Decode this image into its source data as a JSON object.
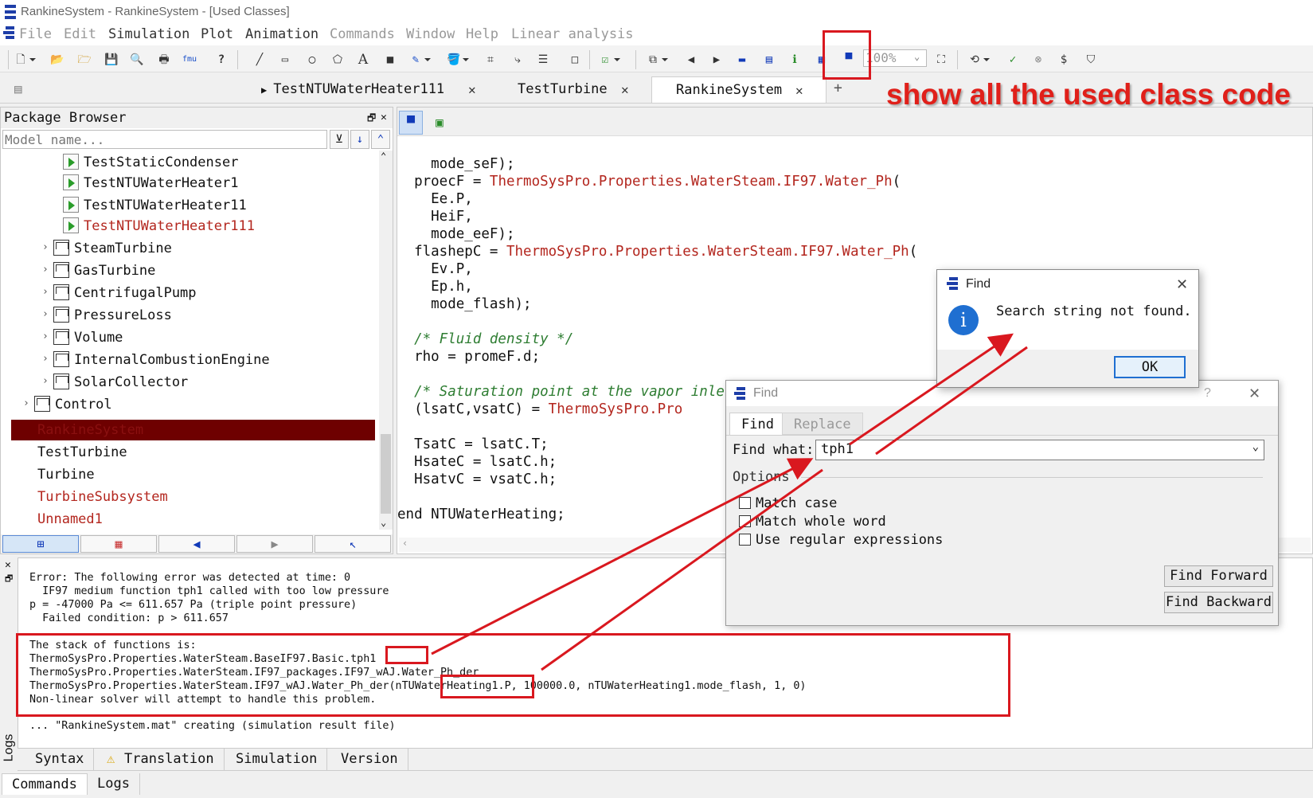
{
  "window": {
    "title": "RankineSystem - RankineSystem - [Used Classes]"
  },
  "menu": [
    "File",
    "Edit",
    "Simulation",
    "Plot",
    "Animation",
    "Commands",
    "Window",
    "Help",
    "Linear analysis"
  ],
  "toolbar": {
    "zoom": "100%"
  },
  "tabs": [
    {
      "label": "TestNTUWaterHeater111"
    },
    {
      "label": "TestTurbine"
    },
    {
      "label": "RankineSystem"
    }
  ],
  "annotation": "show all the used class code",
  "package_browser": {
    "title": "Package Browser",
    "search_placeholder": "Model name...",
    "items": [
      {
        "label": "TestStaticCondenser"
      },
      {
        "label": "TestNTUWaterHeater1"
      },
      {
        "label": "TestNTUWaterHeater11"
      },
      {
        "label": "TestNTUWaterHeater111"
      },
      {
        "label": "SteamTurbine"
      },
      {
        "label": "GasTurbine"
      },
      {
        "label": "CentrifugalPump"
      },
      {
        "label": "PressureLoss"
      },
      {
        "label": "Volume"
      },
      {
        "label": "InternalCombustionEngine"
      },
      {
        "label": "SolarCollector"
      },
      {
        "label": "Control"
      },
      {
        "label": "RankineSystem"
      },
      {
        "label": "TestTurbine"
      },
      {
        "label": "Turbine"
      },
      {
        "label": "TurbineSubsystem"
      },
      {
        "label": "Unnamed1"
      }
    ]
  },
  "code": {
    "l1": "    mode_seF);",
    "l2a": "  proecF = ",
    "l2b": "ThermoSysPro.Properties.WaterSteam.IF97.Water_Ph",
    "l2c": "(",
    "l3": "    Ee.P,",
    "l4": "    HeiF,",
    "l5": "    mode_eeF);",
    "l6a": "  flashepC = ",
    "l6b": "ThermoSysPro.Properties.WaterSteam.IF97.Water_Ph",
    "l6c": "(",
    "l7": "    Ev.P,",
    "l8": "    Ep.h,",
    "l9": "    mode_flash);",
    "l10": "  /* Fluid density */",
    "l11": "  rho = promeF.d;",
    "l12": "  /* Saturation point at the vapor inlet pressure */",
    "l13a": "  (lsatC,vsatC) = ",
    "l13b": "ThermoSysPro.Pro",
    "l14": "  TsatC = lsatC.T;",
    "l15": "  HsateC = lsatC.h;",
    "l16": "  HsatvC = vsatC.h;",
    "l17": "end NTUWaterHeating;"
  },
  "find_dialog": {
    "title": "Find",
    "help": "?",
    "tab_find": "Find",
    "tab_replace": "Replace",
    "find_what_label": "Find what:",
    "find_what_value": "tph1",
    "options_label": "Options",
    "match_case": "Match case",
    "match_whole_word": "Match whole word",
    "use_regex": "Use regular expressions",
    "find_forward": "Find Forward",
    "find_backward": "Find Backward"
  },
  "message_box": {
    "title": "Find",
    "text": "Search string not found.",
    "ok": "OK"
  },
  "logs": {
    "lines": [
      "Error: The following error was detected at time: 0",
      "  IF97 medium function tph1 called with too low pressure",
      "p = -47000 Pa <= 611.657 Pa (triple point pressure)",
      "  Failed condition: p > 611.657",
      "The stack of functions is:",
      "ThermoSysPro.Properties.WaterSteam.BaseIF97.Basic.tph1",
      "ThermoSysPro.Properties.WaterSteam.IF97_packages.IF97_wAJ.Water_Ph_der",
      "ThermoSysPro.Properties.WaterSteam.IF97_wAJ.Water_Ph_der(nTUWaterHeating1.P, 100000.0, nTUWaterHeating1.mode_flash, 1, 0)",
      "Non-linear solver will attempt to handle this problem.",
      "... \"RankineSystem.mat\" creating (simulation result file)"
    ],
    "side_label": "Logs"
  },
  "bottom_tabs": [
    "Syntax",
    "Translation",
    "Simulation",
    "Version"
  ],
  "command_tabs": [
    "Commands",
    "Logs"
  ],
  "colors": {
    "annotation": "#e0201a",
    "selected_row": "#6e0000",
    "code_red": "#b3261e",
    "code_green": "#2e7d32"
  }
}
